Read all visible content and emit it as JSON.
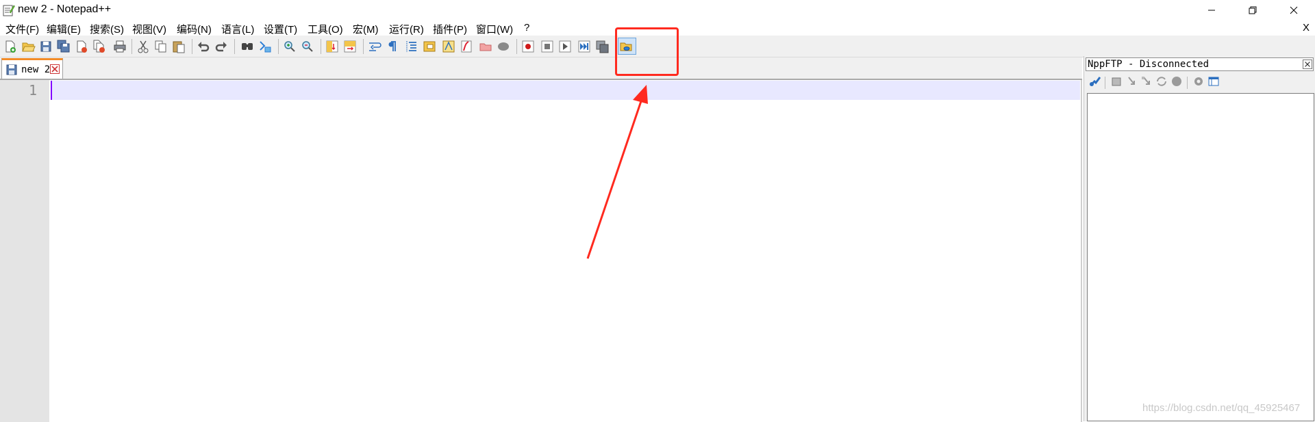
{
  "window": {
    "title": "new 2 - Notepad++",
    "icon": "notepadpp-icon"
  },
  "menu": {
    "items": [
      "文件(F)",
      "编辑(E)",
      "搜索(S)",
      "视图(V)",
      "编码(N)",
      "语言(L)",
      "设置(T)",
      "工具(O)",
      "宏(M)",
      "运行(R)",
      "插件(P)",
      "窗口(W)",
      "?"
    ],
    "close_label": "X"
  },
  "toolbar": {
    "icons": [
      "new-file-icon",
      "open-file-icon",
      "save-icon",
      "save-all-icon",
      "close-icon",
      "close-all-icon",
      "print-icon",
      "cut-icon",
      "copy-icon",
      "paste-icon",
      "undo-icon",
      "redo-icon",
      "find-icon",
      "replace-icon",
      "zoom-in-icon",
      "zoom-out-icon",
      "sync-vertical-icon",
      "sync-horizontal-icon",
      "word-wrap-icon",
      "show-all-chars-icon",
      "indent-guide-icon",
      "doc-map-icon",
      "function-list-icon",
      "folder-workspace-icon",
      "monitoring-icon",
      "record-macro-icon",
      "stop-macro-icon",
      "play-macro-icon",
      "run-macro-multiple-icon",
      "save-macro-icon",
      "nppftp-show-icon"
    ],
    "highlighted": "nppftp-show-icon"
  },
  "tabs": [
    {
      "label": "new 2",
      "active": true
    }
  ],
  "editor": {
    "line_numbers": [
      "1"
    ],
    "content": ""
  },
  "ftp_panel": {
    "title": "NppFTP - Disconnected",
    "toolbar_icons": [
      "connect-icon",
      "upload-icon",
      "download-icon",
      "download-to-icon",
      "refresh-icon",
      "abort-icon",
      "settings-icon",
      "message-window-icon"
    ]
  },
  "annotation": {
    "color": "#ff2a1f"
  },
  "watermark": "https://blog.csdn.net/qq_45925467",
  "colors": {
    "active_tab_accent": "#f28c28",
    "current_line": "#e8e8ff",
    "caret": "#8000ff"
  }
}
